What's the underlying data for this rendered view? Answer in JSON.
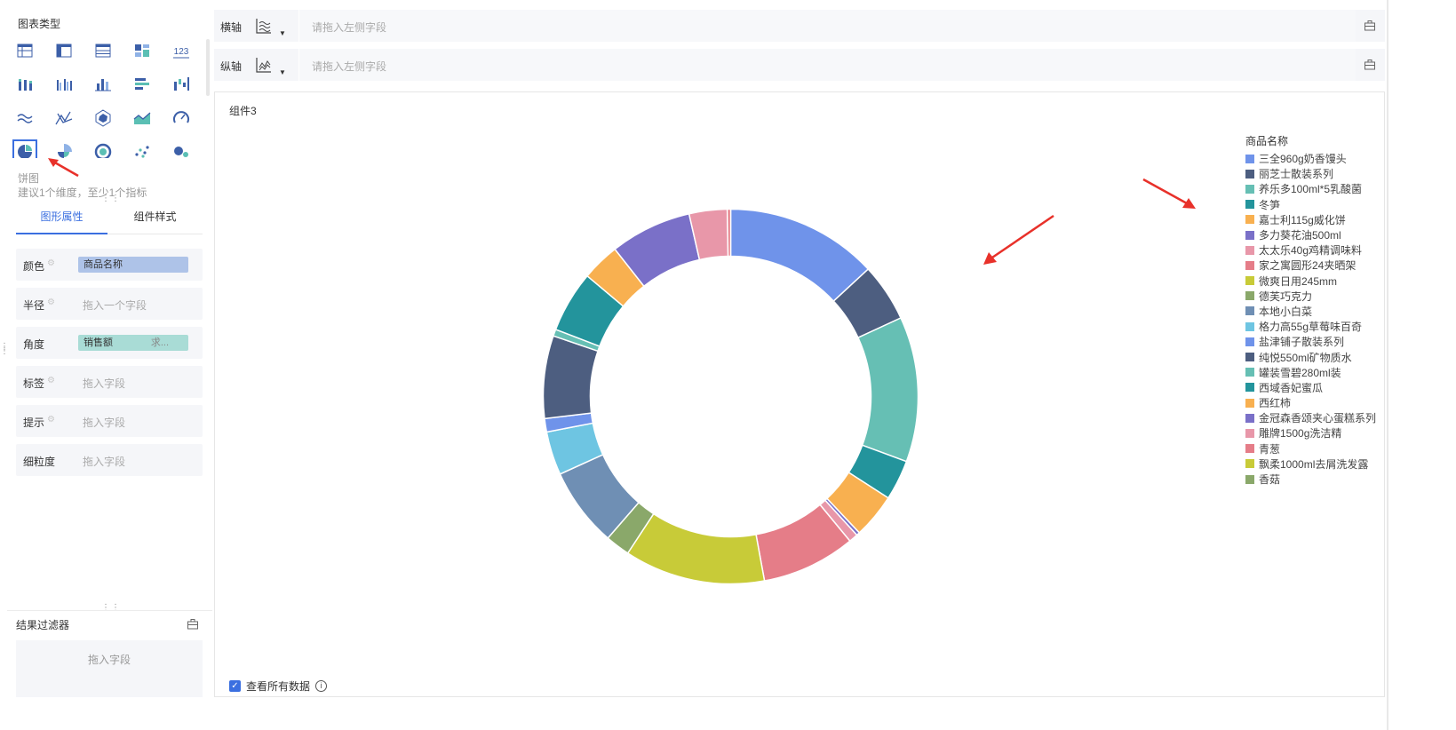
{
  "left_panel": {
    "chart_type_title": "图表类型",
    "selected_type_name": "饼图",
    "selected_type_hint": "建议1个维度，至少1个指标",
    "chart_icon_grid": [
      [
        "table-icon",
        "cross-table-icon",
        "detail-table-icon",
        "kpi-board-icon",
        "number-card-icon"
      ],
      [
        "stacked-bar-icon",
        "grouped-bar-icon",
        "column-chart-icon",
        "horizontal-bar-icon",
        "waterfall-chart-icon"
      ],
      [
        "line-chart-icon",
        "multi-line-chart-icon",
        "radar-chart-icon",
        "area-chart-icon",
        "gauge-chart-icon"
      ],
      [
        "pie-chart-icon",
        "rose-chart-icon",
        "sunburst-chart-icon",
        "scatter-chart-icon",
        "bubble-chart-icon"
      ]
    ],
    "tabs": {
      "shape_props": "图形属性",
      "component_style": "组件样式"
    },
    "fields": {
      "color": {
        "label": "颜色",
        "value": "商品名称"
      },
      "radius": {
        "label": "半径",
        "placeholder": "拖入一个字段"
      },
      "angle": {
        "label": "角度",
        "value": "销售额",
        "agg": "求..."
      },
      "label": {
        "label": "标签",
        "placeholder": "拖入字段"
      },
      "tooltip": {
        "label": "提示",
        "placeholder": "拖入字段"
      },
      "granularity": {
        "label": "细粒度",
        "placeholder": "拖入字段"
      }
    },
    "result_filter": {
      "title": "结果过滤器",
      "placeholder": "拖入字段"
    }
  },
  "axis": {
    "x": {
      "label": "横轴",
      "placeholder": "请拖入左侧字段"
    },
    "y": {
      "label": "纵轴",
      "placeholder": "请拖入左侧字段"
    }
  },
  "canvas": {
    "component_title": "组件3",
    "view_all_label": "查看所有数据"
  },
  "chart_data": {
    "type": "pie",
    "donut": true,
    "legend_title": "商品名称",
    "legend_position": "right",
    "categories": [
      "三全960g奶香馒头",
      "丽芝士散装系列",
      "养乐多100ml*5乳酸菌",
      "冬笋",
      "嘉士利115g威化饼",
      "多力葵花油500ml",
      "太太乐40g鸡精调味料",
      "家之寓圆形24夹晒架",
      "微爽日用245mm",
      "德芙巧克力",
      "本地小白菜",
      "格力高55g草莓味百奇",
      "盐津铺子散装系列",
      "纯悦550ml矿物质水",
      "罐装雪碧280ml装",
      "西域香妃蜜瓜",
      "西红柿",
      "金冠森香颂夹心蛋糕系列",
      "雕牌1500g洗洁精",
      "青葱",
      "飘柔1000ml去屑洗发露",
      "香菇"
    ],
    "colors": [
      "#6f93ea",
      "#4d5e80",
      "#66bfb4",
      "#23949c",
      "#f8b050",
      "#7a70c8",
      "#e897a9",
      "#e57d88",
      "#c8cb38",
      "#8aa86a",
      "#6f8fb4",
      "#6ec5e2",
      "#6f93ea",
      "#4d5e80",
      "#66bfb4",
      "#23949c",
      "#f8b050",
      "#7a70c8",
      "#e897a9",
      "#e57d88",
      "#c8cb38",
      "#8aa86a"
    ],
    "slices_clockwise_from_top": [
      {
        "category": "三全960g奶香馒头",
        "value": 13.6
      },
      {
        "category": "丽芝士散装系列",
        "value": 5.2
      },
      {
        "category": "养乐多100ml*5乳酸菌",
        "value": 13.0
      },
      {
        "category": "冬笋",
        "value": 3.6
      },
      {
        "category": "嘉士利115g威化饼",
        "value": 4.0
      },
      {
        "category": "多力葵花油500ml",
        "value": 0.3
      },
      {
        "category": "太太乐40g鸡精调味料",
        "value": 0.8
      },
      {
        "category": "家之寓圆形24夹晒架",
        "value": 8.4
      },
      {
        "category": "微爽日用245mm",
        "value": 12.6
      },
      {
        "category": "德芙巧克力",
        "value": 2.2
      },
      {
        "category": "本地小白菜",
        "value": 7.1
      },
      {
        "category": "格力高55g草莓味百奇",
        "value": 3.9
      },
      {
        "category": "盐津铺子散装系列",
        "value": 1.2
      },
      {
        "category": "纯悦550ml矿物质水",
        "value": 7.4
      },
      {
        "category": "罐装雪碧280ml装",
        "value": 0.6
      },
      {
        "category": "西域香妃蜜瓜",
        "value": 5.5
      },
      {
        "category": "西红柿",
        "value": 3.4
      },
      {
        "category": "金冠森香颂夹心蛋糕系列",
        "value": 7.3
      },
      {
        "category": "雕牌1500g洗洁精",
        "value": 3.4
      },
      {
        "category": "青葱",
        "value": 0.3
      }
    ]
  }
}
